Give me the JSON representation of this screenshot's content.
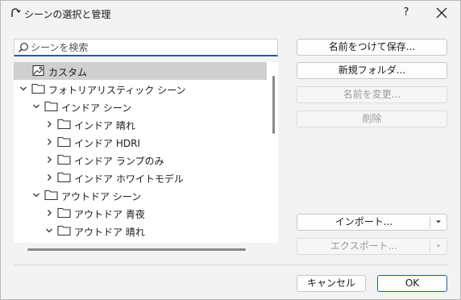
{
  "window": {
    "title": "シーンの選択と管理",
    "help_label": "?"
  },
  "search": {
    "placeholder": "シーンを検索",
    "value": ""
  },
  "tree": {
    "items": [
      {
        "label": "カスタム",
        "type": "scene",
        "level": 0,
        "expander": "none",
        "selected": true
      },
      {
        "label": "フォトリアリスティック シーン",
        "type": "folder",
        "level": 0,
        "expander": "expanded",
        "selected": false
      },
      {
        "label": "インドア シーン",
        "type": "folder",
        "level": 1,
        "expander": "expanded",
        "selected": false
      },
      {
        "label": "インドア 晴れ",
        "type": "folder",
        "level": 2,
        "expander": "collapsed",
        "selected": false
      },
      {
        "label": "インドア HDRI",
        "type": "folder",
        "level": 2,
        "expander": "collapsed",
        "selected": false
      },
      {
        "label": "インドア ランプのみ",
        "type": "folder",
        "level": 2,
        "expander": "collapsed",
        "selected": false
      },
      {
        "label": "インドア ホワイトモデル",
        "type": "folder",
        "level": 2,
        "expander": "collapsed",
        "selected": false
      },
      {
        "label": "アウトドア シーン",
        "type": "folder",
        "level": 1,
        "expander": "expanded",
        "selected": false
      },
      {
        "label": "アウトドア 青夜",
        "type": "folder",
        "level": 2,
        "expander": "collapsed",
        "selected": false
      },
      {
        "label": "アウトドア 晴れ",
        "type": "folder",
        "level": 2,
        "expander": "expanded",
        "selected": false
      }
    ]
  },
  "actions": {
    "save_label": "名前をつけて保存...",
    "new_folder_label": "新規フォルダ...",
    "rename_label": "名前を変更...",
    "delete_label": "削除",
    "import_label": "インポート...",
    "export_label": "エクスポート..."
  },
  "footer": {
    "cancel_label": "キャンセル",
    "ok_label": "OK"
  },
  "colors": {
    "accent": "#1f5ea8",
    "selection": "#cfcfcf",
    "disabled_text": "#9a9a9a"
  }
}
